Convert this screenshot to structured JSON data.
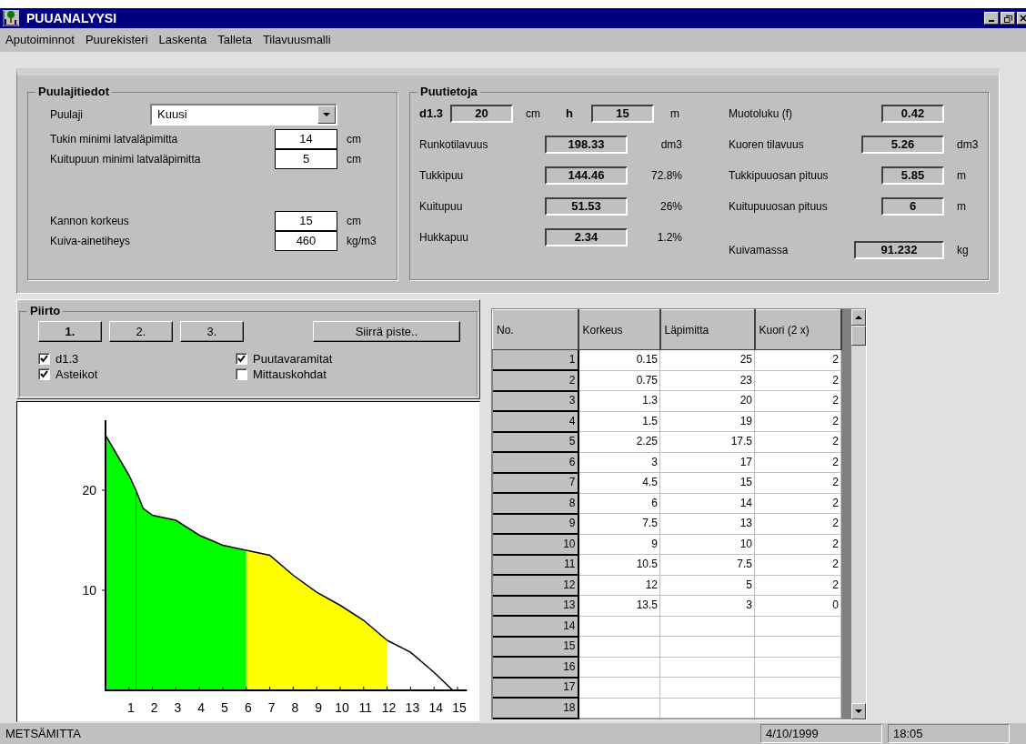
{
  "window": {
    "title": "PUUANALYYSI"
  },
  "menu": [
    "Aputoiminnot",
    "Puurekisteri",
    "Laskenta",
    "Talleta",
    "Tilavuusmalli"
  ],
  "puulajitiedot": {
    "title": "Puulajitiedot",
    "species_label": "Puulaji",
    "species_value": "Kuusi",
    "fields": [
      {
        "label": "Tukin minimi latvaläpimitta",
        "value": "14",
        "unit": "cm"
      },
      {
        "label": "Kuitupuun minimi latvaläpimitta",
        "value": "5",
        "unit": "cm"
      },
      {
        "label": "Kannon korkeus",
        "value": "15",
        "unit": "cm"
      },
      {
        "label": "Kuiva-ainetiheys",
        "value": "460",
        "unit": "kg/m3"
      }
    ]
  },
  "puutietoja": {
    "title": "Puutietoja",
    "d13": {
      "label": "d1.3",
      "value": "20",
      "unit": "cm"
    },
    "h": {
      "label": "h",
      "value": "15",
      "unit": "m"
    },
    "left": [
      {
        "label": "Runkotilavuus",
        "value": "198.33",
        "unit": "dm3"
      },
      {
        "label": "Tukkipuu",
        "value": "144.46",
        "unit": "72.8%"
      },
      {
        "label": "Kuitupuu",
        "value": "51.53",
        "unit": "26%"
      },
      {
        "label": "Hukkapuu",
        "value": "2.34",
        "unit": "1.2%"
      }
    ],
    "right": [
      {
        "label": "Muotoluku (f)",
        "value": "0.42"
      },
      {
        "label": "Kuoren tilavuus",
        "value": "5.26",
        "unit": "dm3"
      },
      {
        "label": "Tukkipuuosan pituus",
        "value": "5.85",
        "unit": "m"
      },
      {
        "label": "Kuitupuuosan pituus",
        "value": "6",
        "unit": "m"
      },
      {
        "label": "Kuivamassa",
        "value": "91.232",
        "unit": "kg"
      }
    ]
  },
  "piirto": {
    "title": "Piirto",
    "buttons": [
      "1.",
      "2.",
      "3."
    ],
    "move_button": "Siirrä piste..",
    "checkboxes": [
      {
        "label": "d1.3",
        "checked": true
      },
      {
        "label": "Puutavaramitat",
        "checked": true
      },
      {
        "label": "Asteikot",
        "checked": true
      },
      {
        "label": "Mittauskohdat",
        "checked": false
      }
    ]
  },
  "chart": {
    "chart_data": {
      "type": "area",
      "x": [
        0,
        0.5,
        1,
        1.3,
        1.6,
        2,
        3,
        4,
        5,
        6,
        7,
        8,
        9,
        10,
        11,
        12,
        13,
        14,
        14.8
      ],
      "series": [
        {
          "color": "#00ff00",
          "values": [
            25.5,
            23.5,
            21.5,
            20,
            18.2,
            17.5,
            17,
            15.5,
            14.5,
            14,
            null,
            null,
            null,
            null,
            null,
            null,
            null,
            null,
            null
          ]
        },
        {
          "color": "#ffff00",
          "values": [
            null,
            null,
            null,
            null,
            null,
            null,
            null,
            null,
            null,
            14,
            13.5,
            11.5,
            9.8,
            8.5,
            7,
            5,
            null,
            null,
            null
          ]
        },
        {
          "color": "#ffffff",
          "values": [
            null,
            null,
            null,
            null,
            null,
            null,
            null,
            null,
            null,
            null,
            null,
            null,
            null,
            null,
            null,
            5,
            3.8,
            1.8,
            0
          ]
        }
      ],
      "xlim": [
        0,
        15.4
      ],
      "ylim": [
        0,
        27
      ],
      "xticks": [
        1,
        2,
        3,
        4,
        5,
        6,
        7,
        8,
        9,
        10,
        11,
        12,
        13,
        14,
        15
      ],
      "yticks": [
        10,
        20
      ],
      "ref_lines": [
        {
          "axis": "x",
          "value": 1.3,
          "color": "#ff0000"
        }
      ]
    }
  },
  "table": {
    "columns": [
      "No.",
      "Korkeus",
      "Läpimitta",
      "Kuori (2 x)"
    ],
    "rows": [
      [
        "1",
        "0.15",
        "25",
        "2"
      ],
      [
        "2",
        "0.75",
        "23",
        "2"
      ],
      [
        "3",
        "1.3",
        "20",
        "2"
      ],
      [
        "4",
        "1.5",
        "19",
        "2"
      ],
      [
        "5",
        "2.25",
        "17.5",
        "2"
      ],
      [
        "6",
        "3",
        "17",
        "2"
      ],
      [
        "7",
        "4.5",
        "15",
        "2"
      ],
      [
        "8",
        "6",
        "14",
        "2"
      ],
      [
        "9",
        "7.5",
        "13",
        "2"
      ],
      [
        "10",
        "9",
        "10",
        "2"
      ],
      [
        "11",
        "10.5",
        "7.5",
        "2"
      ],
      [
        "12",
        "12",
        "5",
        "2"
      ],
      [
        "13",
        "13.5",
        "3",
        "0"
      ],
      [
        "14",
        "",
        "",
        ""
      ],
      [
        "15",
        "",
        "",
        ""
      ],
      [
        "16",
        "",
        "",
        ""
      ],
      [
        "17",
        "",
        "",
        ""
      ],
      [
        "18",
        "",
        "",
        ""
      ]
    ]
  },
  "status_bar": {
    "app": "METSÄMITTA",
    "date": "4/10/1999",
    "time": "18:05"
  }
}
